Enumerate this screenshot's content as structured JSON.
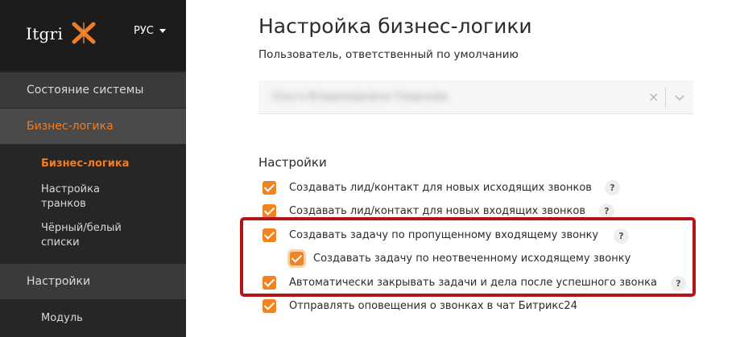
{
  "sidebar": {
    "logo": "Itgri",
    "language": "РУС",
    "items": [
      {
        "label": "Состояние системы"
      },
      {
        "label": "Бизнес-логика"
      },
      {
        "label": "Бизнес-логика"
      },
      {
        "label": "Настройка\nтранков"
      },
      {
        "label": "Чёрный/белый\nсписки"
      },
      {
        "label": "Настройки"
      },
      {
        "label": "Модуль"
      }
    ]
  },
  "main": {
    "title": "Настройка бизнес-логики",
    "default_user_label": "Пользователь, ответственный по умолчанию",
    "default_user_value": "Ольга Владимировна Смирнова",
    "settings_title": "Настройки",
    "settings": [
      {
        "label": "Создавать лид/контакт для новых исходящих звонков",
        "checked": true
      },
      {
        "label": "Создавать лид/контакт для новых входящих звонков",
        "checked": true
      },
      {
        "label": "Создавать задачу по пропущенному входящему звонку",
        "checked": true
      },
      {
        "label": "Создавать задачу по неотвеченному исходящему звонку",
        "checked": true
      },
      {
        "label": "Автоматически закрывать задачи и дела после успешного звонка",
        "checked": true
      },
      {
        "label": "Отправлять оповещения о звонках в чат Битрикс24",
        "checked": true
      }
    ],
    "help_glyph": "?"
  },
  "colors": {
    "accent": "#f07c23",
    "highlight_border": "#b51417",
    "sidebar_bg": "#262626"
  }
}
